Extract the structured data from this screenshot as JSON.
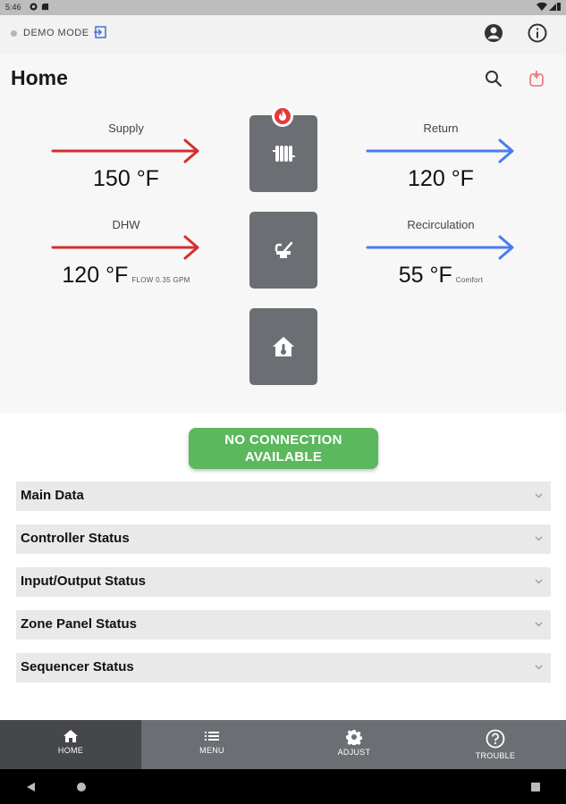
{
  "status_bar": {
    "time": "5:46"
  },
  "top_bar": {
    "mode_label": "DEMO MODE"
  },
  "page": {
    "title": "Home"
  },
  "supply": {
    "label": "Supply",
    "value": "150 °F"
  },
  "return": {
    "label": "Return",
    "value": "120 °F"
  },
  "dhw": {
    "label": "DHW",
    "value": "120 °F",
    "sub": "FLOW 0.35 GPM"
  },
  "recirculation": {
    "label": "Recirculation",
    "value": "55 °F",
    "sub": "Comfort"
  },
  "connection_button": {
    "line1": "NO CONNECTION",
    "line2": "AVAILABLE"
  },
  "sections": [
    {
      "title": "Main Data"
    },
    {
      "title": "Controller Status"
    },
    {
      "title": "Input/Output Status"
    },
    {
      "title": "Zone Panel Status"
    },
    {
      "title": "Sequencer Status"
    }
  ],
  "nav": [
    {
      "label": "HOME",
      "icon": "home-icon",
      "active": true
    },
    {
      "label": "MENU",
      "icon": "menu-icon",
      "active": false
    },
    {
      "label": "ADJUST",
      "icon": "gear-icon",
      "active": false
    },
    {
      "label": "TROUBLE",
      "icon": "help-circle-icon",
      "active": false
    }
  ],
  "colors": {
    "supply_red": "#d32f2f",
    "return_blue": "#4a7cf0",
    "connection_green": "#5cb85c",
    "tile_gray": "#6b6e73",
    "accent_red": "#e53935"
  }
}
